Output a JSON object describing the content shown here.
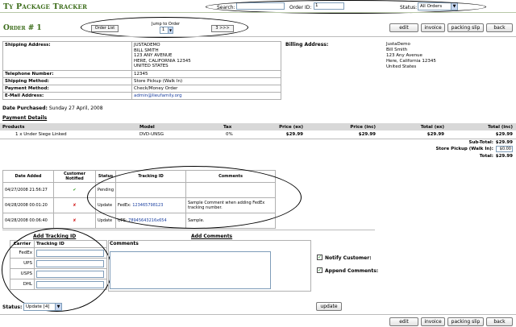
{
  "app_title": "Ty Package Tracker",
  "search": {
    "label": "Search:",
    "value": ""
  },
  "order_id": {
    "label": "Order ID:",
    "value": "1"
  },
  "status_filter": {
    "label": "Status:",
    "value": "All Orders"
  },
  "order_heading": "Order # 1",
  "nav": {
    "order_list": "Order List",
    "jump_label": "Jump to Order",
    "jump_value": "1",
    "next": "3 >>>"
  },
  "actions": {
    "edit": "edit",
    "invoice": "invoice",
    "packing_slip": "packing slip",
    "back": "back"
  },
  "shipping": {
    "label": "Shipping Address:",
    "lines": [
      "JUSTADEMO",
      "BILL SMITH",
      "123 ANY AVENUE",
      "HERE, CALIFORNIA 12345",
      "UNITED STATES"
    ],
    "telephone_label": "Telephone Number:",
    "telephone": "12345",
    "method_label": "Shipping Method:",
    "method": "Store Pickup (Walk In)",
    "payment_label": "Payment Method:",
    "payment": "Check/Money Order",
    "email_label": "E-Mail Address:",
    "email": "admin@lieufamily.org"
  },
  "billing": {
    "label": "Billing Address:",
    "lines": [
      "JustaDemo",
      "Bill Smith",
      "123 Any Avenue",
      "Here, California 12345",
      "United States"
    ]
  },
  "date_purchased": {
    "label": "Date Purchased:",
    "value": "Sunday 27 April, 2008"
  },
  "payment_details": "Payment Details",
  "products": {
    "headers": {
      "products": "Products",
      "model": "Model",
      "tax": "Tax",
      "price_ex": "Price (ex)",
      "price_inc": "Price (inc)",
      "total_ex": "Total (ex)",
      "total_inc": "Total (inc)"
    },
    "rows": [
      {
        "qty_name": "1 x Under Siege Linked",
        "model": "DVD-UNSG",
        "tax": "0%",
        "price_ex": "$29.99",
        "price_inc": "$29.99",
        "total_ex": "$29.99",
        "total_inc": "$29.99"
      }
    ]
  },
  "totals": {
    "subtotal_label": "Sub-Total:",
    "subtotal": "$29.99",
    "shipping_label": "Store Pickup (Walk In):",
    "shipping_value": "$0.00",
    "total_label": "Total:",
    "total": "$29.99"
  },
  "history": {
    "headers": {
      "date": "Date Added",
      "notified": "Customer Notified",
      "status": "Status",
      "tracking": "Tracking ID",
      "comments": "Comments"
    },
    "rows": [
      {
        "date": "04/27/2008 21:56:27",
        "notified": true,
        "status": "Pending",
        "carrier": "",
        "tracking": "",
        "comment": ""
      },
      {
        "date": "04/28/2008 00:01:20",
        "notified": false,
        "status": "Update",
        "carrier": "FedEx:",
        "tracking": "123465798123",
        "comment": "Sample Comment when adding FedEx tracking number."
      },
      {
        "date": "04/28/2008 00:06:40",
        "notified": false,
        "status": "Update",
        "carrier": "UPS:",
        "tracking": "78945643216x654",
        "comment": "Sample."
      }
    ]
  },
  "add_tracking": {
    "title": "Add Tracking ID",
    "carrier_header": "Carrier",
    "id_header": "Tracking ID",
    "carriers": [
      "FedEx",
      "UPS",
      "USPS",
      "DHL"
    ]
  },
  "add_comments": {
    "title": "Add Comments",
    "label": "Comments"
  },
  "notify_customer": "Notify Customer:",
  "append_comments": "Append Comments:",
  "status_select": {
    "label": "Status:",
    "value": "Update [4]"
  },
  "update_button": "update"
}
